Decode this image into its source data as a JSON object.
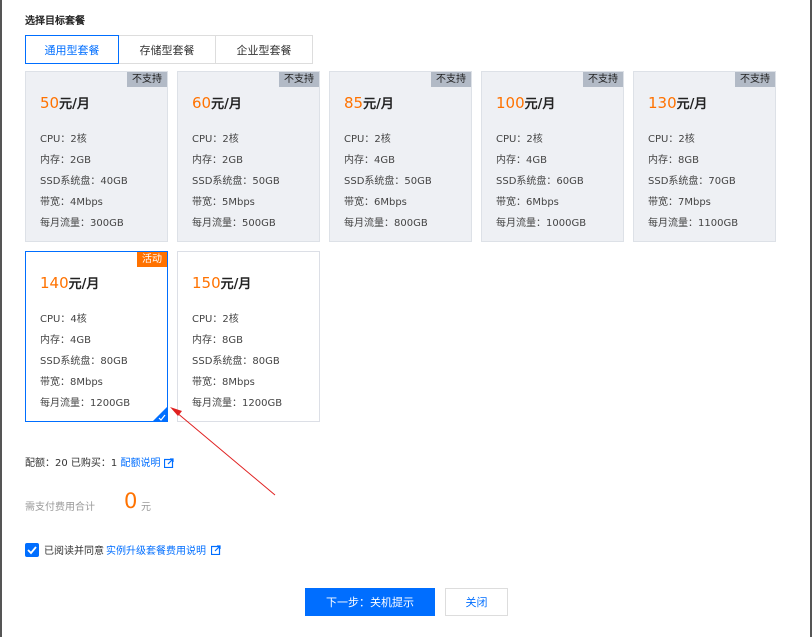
{
  "section_title": "选择目标套餐",
  "tabs": [
    {
      "label": "通用型套餐",
      "active": true
    },
    {
      "label": "存储型套餐",
      "active": false
    },
    {
      "label": "企业型套餐",
      "active": false
    }
  ],
  "price_unit": "元/月",
  "packages": [
    {
      "price": "50",
      "badge": "不支持",
      "status": "disabled",
      "specs": [
        "CPU：2核",
        "内存：2GB",
        "SSD系统盘：40GB",
        "带宽：4Mbps",
        "每月流量：300GB"
      ]
    },
    {
      "price": "60",
      "badge": "不支持",
      "status": "disabled",
      "specs": [
        "CPU：2核",
        "内存：2GB",
        "SSD系统盘：50GB",
        "带宽：5Mbps",
        "每月流量：500GB"
      ]
    },
    {
      "price": "85",
      "badge": "不支持",
      "status": "disabled",
      "specs": [
        "CPU：2核",
        "内存：4GB",
        "SSD系统盘：50GB",
        "带宽：6Mbps",
        "每月流量：800GB"
      ]
    },
    {
      "price": "100",
      "badge": "不支持",
      "status": "disabled",
      "specs": [
        "CPU：2核",
        "内存：4GB",
        "SSD系统盘：60GB",
        "带宽：6Mbps",
        "每月流量：1000GB"
      ]
    },
    {
      "price": "130",
      "badge": "不支持",
      "status": "disabled",
      "specs": [
        "CPU：2核",
        "内存：8GB",
        "SSD系统盘：70GB",
        "带宽：7Mbps",
        "每月流量：1100GB"
      ]
    },
    {
      "price": "140",
      "badge": "活动",
      "status": "selected",
      "specs": [
        "CPU：4核",
        "内存：4GB",
        "SSD系统盘：80GB",
        "带宽：8Mbps",
        "每月流量：1200GB"
      ]
    },
    {
      "price": "150",
      "badge": "",
      "status": "available",
      "specs": [
        "CPU：2核",
        "内存：8GB",
        "SSD系统盘：80GB",
        "带宽：8Mbps",
        "每月流量：1200GB"
      ]
    }
  ],
  "quota": {
    "text": "配额：20  已购买：1",
    "link": "配额说明"
  },
  "fee": {
    "label": "需支付费用合计",
    "amount": "0",
    "unit": "元"
  },
  "agreement": {
    "text": "已阅读并同意",
    "link": "实例升级套餐费用说明",
    "checked": true
  },
  "buttons": {
    "next": "下一步：关机提示",
    "close": "关闭"
  },
  "colors": {
    "primary": "#006eff",
    "accent": "#ff7200",
    "disabled_bg": "#eef0f4",
    "disabled_badge": "#b2bac6"
  }
}
